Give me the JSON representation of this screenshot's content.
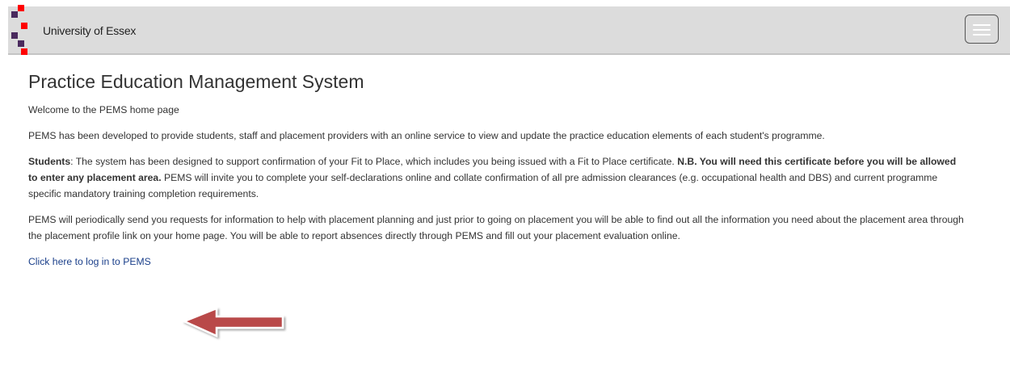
{
  "header": {
    "brand": "University of Essex",
    "logo_colors": [
      "#4a2a5e",
      "#ff0000"
    ]
  },
  "main": {
    "title": "Practice Education Management System",
    "welcome": "Welcome to the PEMS home page",
    "intro": "PEMS has been developed to provide students, staff and placement providers with an online service to view and update the practice education elements of each student's programme.",
    "students_label": "Students",
    "students_text_1": ": The system has been designed to support confirmation of your Fit to Place, which includes you being issued with a Fit to Place certificate. ",
    "students_bold": "N.B. You will need this certificate before you will be allowed to enter any placement area.",
    "students_text_2": " PEMS will invite you to complete your self-declarations online and collate confirmation of all pre admission clearances (e.g. occupational health and DBS) and current programme specific mandatory training completion requirements.",
    "info": "PEMS will periodically send you requests for information to help with placement planning and just prior to going on placement you will be able to find out all the information you need about the placement area through the placement profile link on your home page. You will be able to report absences directly through PEMS and fill out your placement evaluation online.",
    "login_link": "Click here to log in to PEMS"
  },
  "colors": {
    "navbar_bg": "#dcdcdc",
    "link": "#1a3f8a",
    "arrow_fill": "#b94a4a"
  }
}
